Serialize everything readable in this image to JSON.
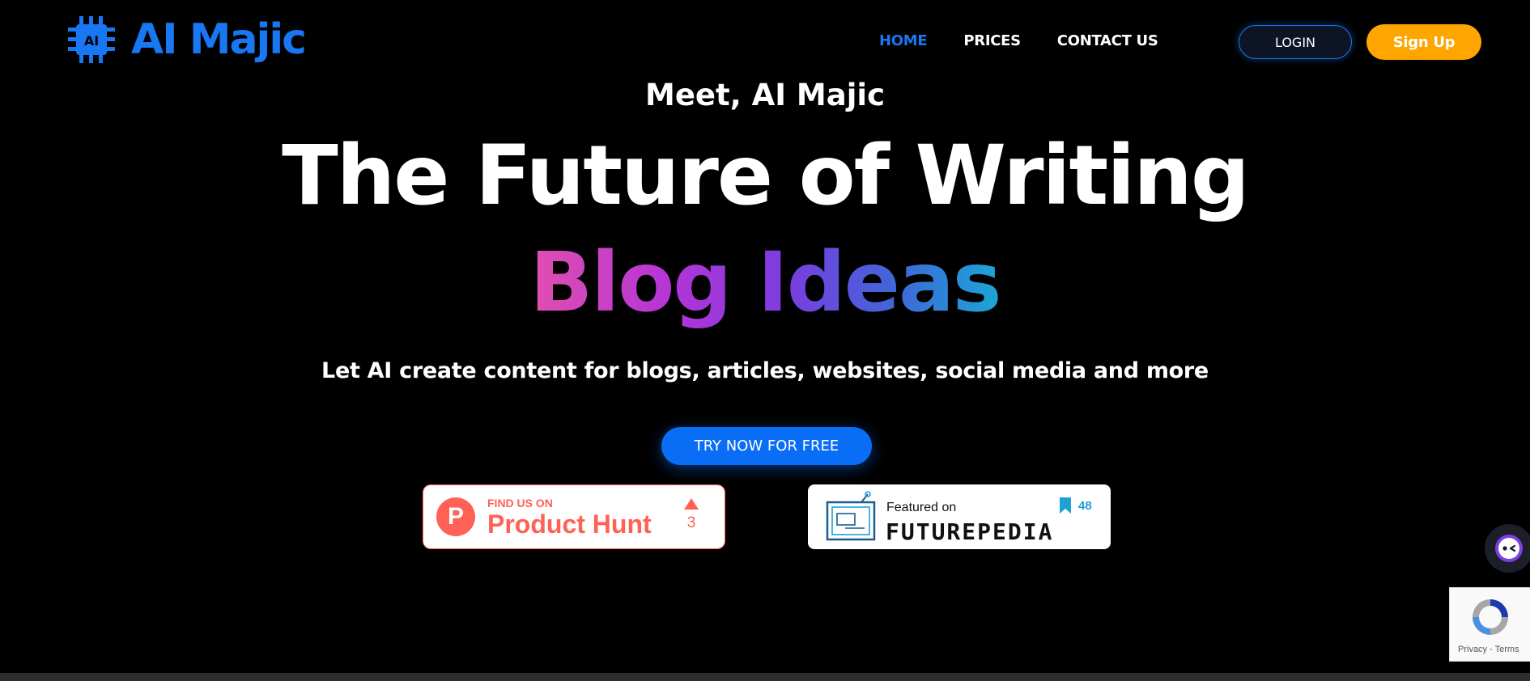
{
  "header": {
    "logo_text": "AI Majic",
    "chip_text": "AI",
    "nav": [
      {
        "label": "HOME",
        "active": true
      },
      {
        "label": "PRICES",
        "active": false
      },
      {
        "label": "CONTACT US",
        "active": false
      }
    ],
    "login_label": "LOGIN",
    "signup_label": "Sign Up"
  },
  "hero": {
    "kicker": "Meet, AI Majic",
    "headline": "The Future of Writing",
    "rotating_word": "Blog Ideas",
    "subhead": "Let AI create content for blogs, articles, websites, social media and more",
    "cta_label": "TRY NOW FOR FREE"
  },
  "badges": {
    "product_hunt": {
      "logo_letter": "P",
      "small": "FIND US ON",
      "big": "Product Hunt",
      "votes": "3"
    },
    "futurepedia": {
      "small": "Featured on",
      "big": "FUTUREPEDIA",
      "saves": "48"
    }
  },
  "recaptcha": {
    "privacy": "Privacy",
    "separator": " - ",
    "terms": "Terms"
  },
  "colors": {
    "brand_blue": "#1877f2",
    "signup_orange": "#ffa500",
    "cta_blue": "#0a6df5",
    "product_hunt": "#ff6154",
    "background": "#000000"
  },
  "icons": [
    "chip-logo-icon",
    "product-hunt-icon",
    "upvote-arrow-icon",
    "futurepedia-tv-icon",
    "bookmark-icon",
    "chat-bot-icon",
    "recaptcha-icon"
  ]
}
